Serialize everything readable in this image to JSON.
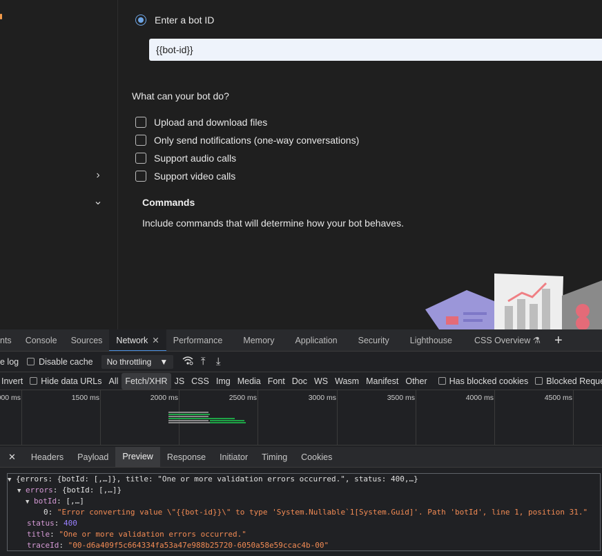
{
  "app": {
    "radio_label": "Enter a bot ID",
    "botid_value": "{{bot-id}}",
    "capabilities_title": "What can your bot do?",
    "capabilities": [
      "Upload and download files",
      "Only send notifications (one-way conversations)",
      "Support audio calls",
      "Support video calls"
    ],
    "commands_title": "Commands",
    "commands_desc": "Include commands that will determine how your bot behaves."
  },
  "devtools": {
    "tabs": [
      "nts",
      "Console",
      "Sources",
      "Network",
      "Performance",
      "Memory",
      "Application",
      "Security",
      "Lighthouse",
      "CSS Overview"
    ],
    "active_tab": "Network",
    "toolbar": {
      "preserve_log": "e log",
      "disable_cache": "Disable cache",
      "throttling": "No throttling"
    },
    "filters": [
      "Invert",
      "Hide data URLs",
      "All",
      "Fetch/XHR",
      "JS",
      "CSS",
      "Img",
      "Media",
      "Font",
      "Doc",
      "WS",
      "Wasm",
      "Manifest",
      "Other",
      "Has blocked cookies",
      "Blocked Requests"
    ],
    "timeline_ticks": [
      "000 ms",
      "1500 ms",
      "2000 ms",
      "2500 ms",
      "3000 ms",
      "3500 ms",
      "4000 ms",
      "4500 ms"
    ],
    "detail_tabs": [
      "Headers",
      "Payload",
      "Preview",
      "Response",
      "Initiator",
      "Timing",
      "Cookies"
    ],
    "active_detail_tab": "Preview",
    "preview": {
      "summary": "{errors: {botId: [,…]}, title: \"One or more validation errors occurred.\", status: 400,…}",
      "errors_summary": "{botId: [,…]}",
      "botid_summary": "[,…]",
      "error_index": "0",
      "error_message": "\"Error converting value \\\"{{bot-id}}\\\" to type 'System.Nullable`1[System.Guid]'. Path 'botId', line 1, position 31.\"",
      "status": "400",
      "title": "\"One or more validation errors occurred.\"",
      "traceId": "\"00-d6a409f5c664334fa53a47e988b25720-6050a58e59ccac4b-00\""
    }
  },
  "colors": {
    "accent": "#4a8fe0",
    "string": "#f28b54",
    "number": "#9980ff",
    "key": "#d69ad6"
  }
}
